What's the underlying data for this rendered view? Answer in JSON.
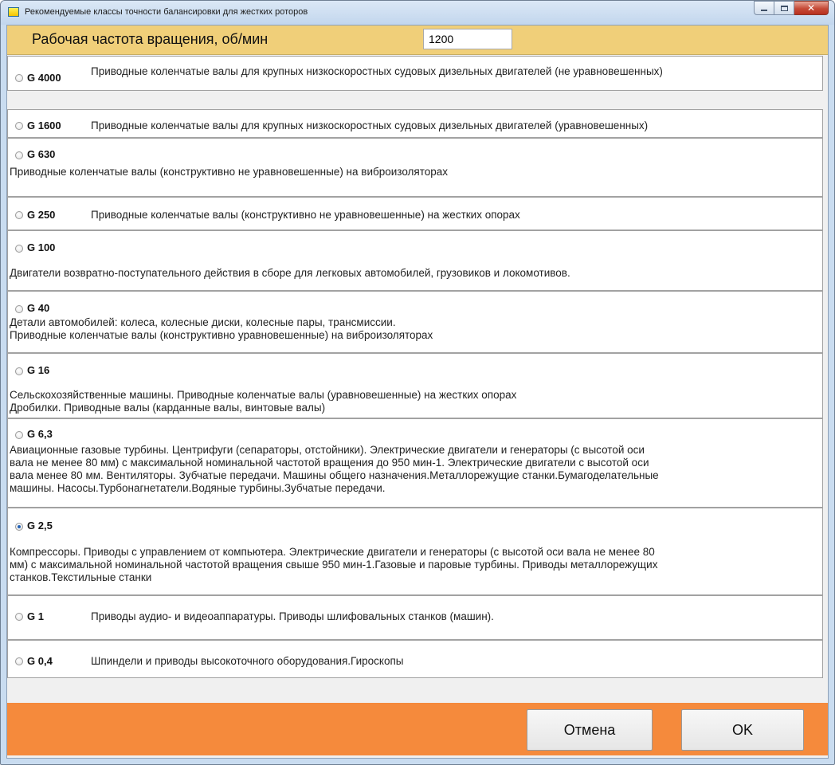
{
  "window": {
    "title": "Рекомендуемые классы точности балансировки для жестких роторов",
    "minimize_label": "minimize",
    "maximize_label": "maximize",
    "close_label": "close"
  },
  "header": {
    "label": "Рабочая частота вращения, об/мин",
    "rpm_value": "1200"
  },
  "classes": [
    {
      "code": "G 4000",
      "selected": false,
      "text": "Приводные коленчатые валы для крупных низкоскоростных судовых дизельных  двигателей  (не уравновешенных)"
    },
    {
      "code": "G 1600",
      "selected": false,
      "text": "Приводные коленчатые валы для крупных низкоскоростных судовых дизельных  двигателей  (уравновешенных)"
    },
    {
      "code": "G 630",
      "selected": false,
      "text": "Приводные коленчатые валы (конструктивно не уравновешенные) на виброизоляторах"
    },
    {
      "code": "G 250",
      "selected": false,
      "text": "Приводные коленчатые валы (конструктивно не уравновешенные) на жестких опорах"
    },
    {
      "code": "G 100",
      "selected": false,
      "text": "Двигатели возвратно-поступательного действия в сборе для легковых автомобилей, грузовиков и локомотивов."
    },
    {
      "code": "G 40",
      "selected": false,
      "text": "Детали автомобилей: колеса, колесные диски, колесные пары, трансмиссии.\nПриводные коленчатые валы (конструктивно уравновешенные) на виброизоляторах"
    },
    {
      "code": "G 16",
      "selected": false,
      "text": "Сельскохозяйственные машины. Приводные коленчатые валы (уравновешенные) на жестких опорах\nДробилки. Приводные валы (карданные валы, винтовые валы)"
    },
    {
      "code": "G 6,3",
      "selected": false,
      "text": "Авиационные газовые турбины. Центрифуги (сепараторы, отстойники). Электрические двигатели и генераторы (с высотой оси\nвала не менее 80 мм) с максимальной номинальной частотой вращения до 950 мин-1. Электрические двигатели с высотой оси\nвала менее 80 мм. Вентиляторы. Зубчатые передачи. Машины общего назначения.Металлорежущие станки.Бумагоделательные\nмашины. Насосы.Турбонагнетатели.Водяные турбины.Зубчатые передачи."
    },
    {
      "code": "G 2,5",
      "selected": true,
      "text": "Компрессоры. Приводы с управлением от компьютера. Электрические двигатели и генераторы (с высотой оси вала не менее 80\nмм) с максимальной номинальной частотой вращения свыше 950 мин-1.Газовые и паровые турбины. Приводы металлорежущих\nстанков.Текстильные станки"
    },
    {
      "code": "G 1",
      "selected": false,
      "text": "Приводы аудио- и видеоаппаратуры. Приводы шлифовальных станков (машин)."
    },
    {
      "code": "G 0,4",
      "selected": false,
      "text": "Шпиндели и приводы высокоточного оборудования.Гироскопы"
    }
  ],
  "buttons": {
    "cancel": "Отмена",
    "ok": "OK"
  },
  "colors": {
    "header_bg": "#f0cf79",
    "footer_bg": "#f58a3c",
    "radio_selected": "#2362b5"
  }
}
